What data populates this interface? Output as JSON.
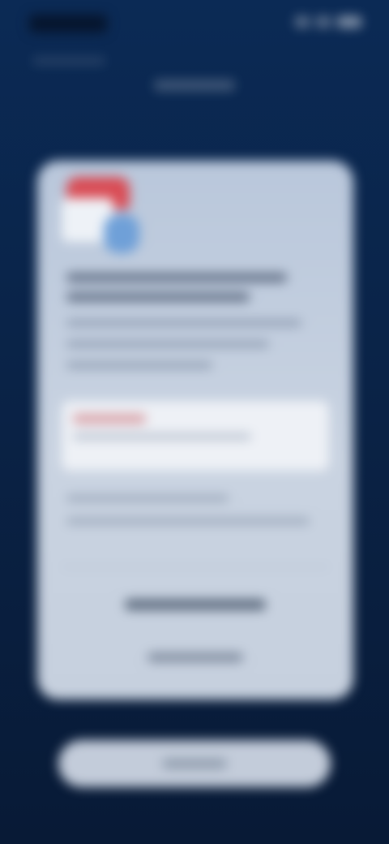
{
  "colors": {
    "background_top": "#0b2a55",
    "background_bottom": "#081a36",
    "card": "#c6d0de",
    "accent_red": "#d94c55",
    "accent_blue": "#6fa0d8",
    "button": "#c3ccda"
  },
  "icons": {
    "card_illustration": "document-illustration-icon"
  },
  "card": {
    "title": "",
    "description": "",
    "highlight_text": "",
    "section_text": "",
    "primary_link": "",
    "secondary_link": ""
  },
  "bottom_button": {
    "label": ""
  }
}
